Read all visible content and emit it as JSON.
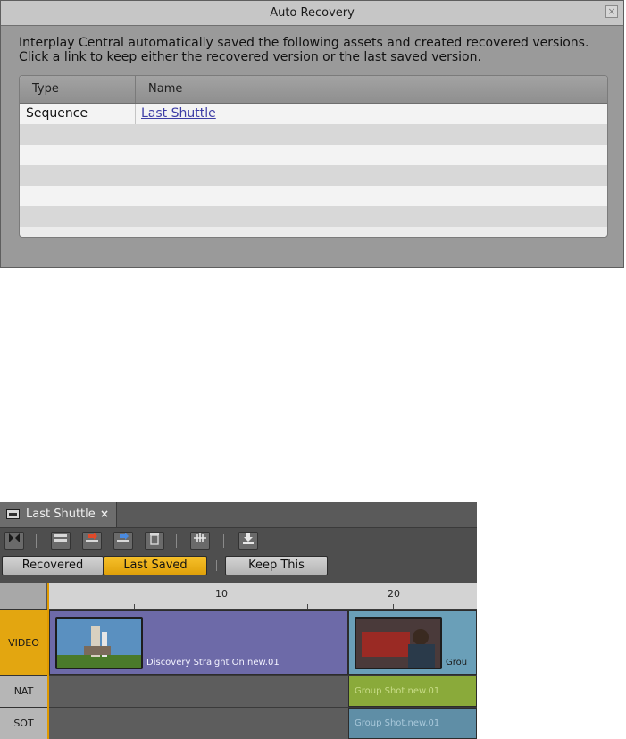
{
  "dialog": {
    "title": "Auto Recovery",
    "close_glyph": "×",
    "message": "Interplay Central automatically saved the following assets and created recovered versions. Click a link to keep either the recovered version or the last saved version.",
    "columns": [
      "Type",
      "Name"
    ],
    "rows": [
      {
        "type": "Sequence",
        "name": "Last Shuttle"
      }
    ]
  },
  "editor": {
    "tab": {
      "label": "Last Shuttle",
      "close": "×"
    },
    "toolbar_icons": [
      "mark-clip-icon",
      "lift-icon",
      "extract-icon",
      "overwrite-icon",
      "delete-icon",
      "split-audio-icon",
      "download-icon"
    ],
    "buttons": {
      "recovered": "Recovered",
      "last_saved": "Last Saved",
      "keep_this": "Keep This"
    },
    "ruler": {
      "marks": [
        "10",
        "20"
      ]
    },
    "tracks": {
      "video": {
        "label": "VIDEO",
        "clips": [
          {
            "name": "Discovery Straight On.new.01"
          },
          {
            "name": "Grou"
          }
        ]
      },
      "nat": {
        "label": "NAT",
        "clip": "Group Shot.new.01"
      },
      "sot": {
        "label": "SOT",
        "clip": "Group Shot.new.01"
      }
    },
    "colors": {
      "active_button": "#f0b51a",
      "video_track_label": "#e3a610",
      "video_clip_1": "#6d6aa8",
      "video_clip_2": "#6a9fb8",
      "nat_clip": "#8aaa3a",
      "sot_clip": "#5f8ea6"
    }
  }
}
